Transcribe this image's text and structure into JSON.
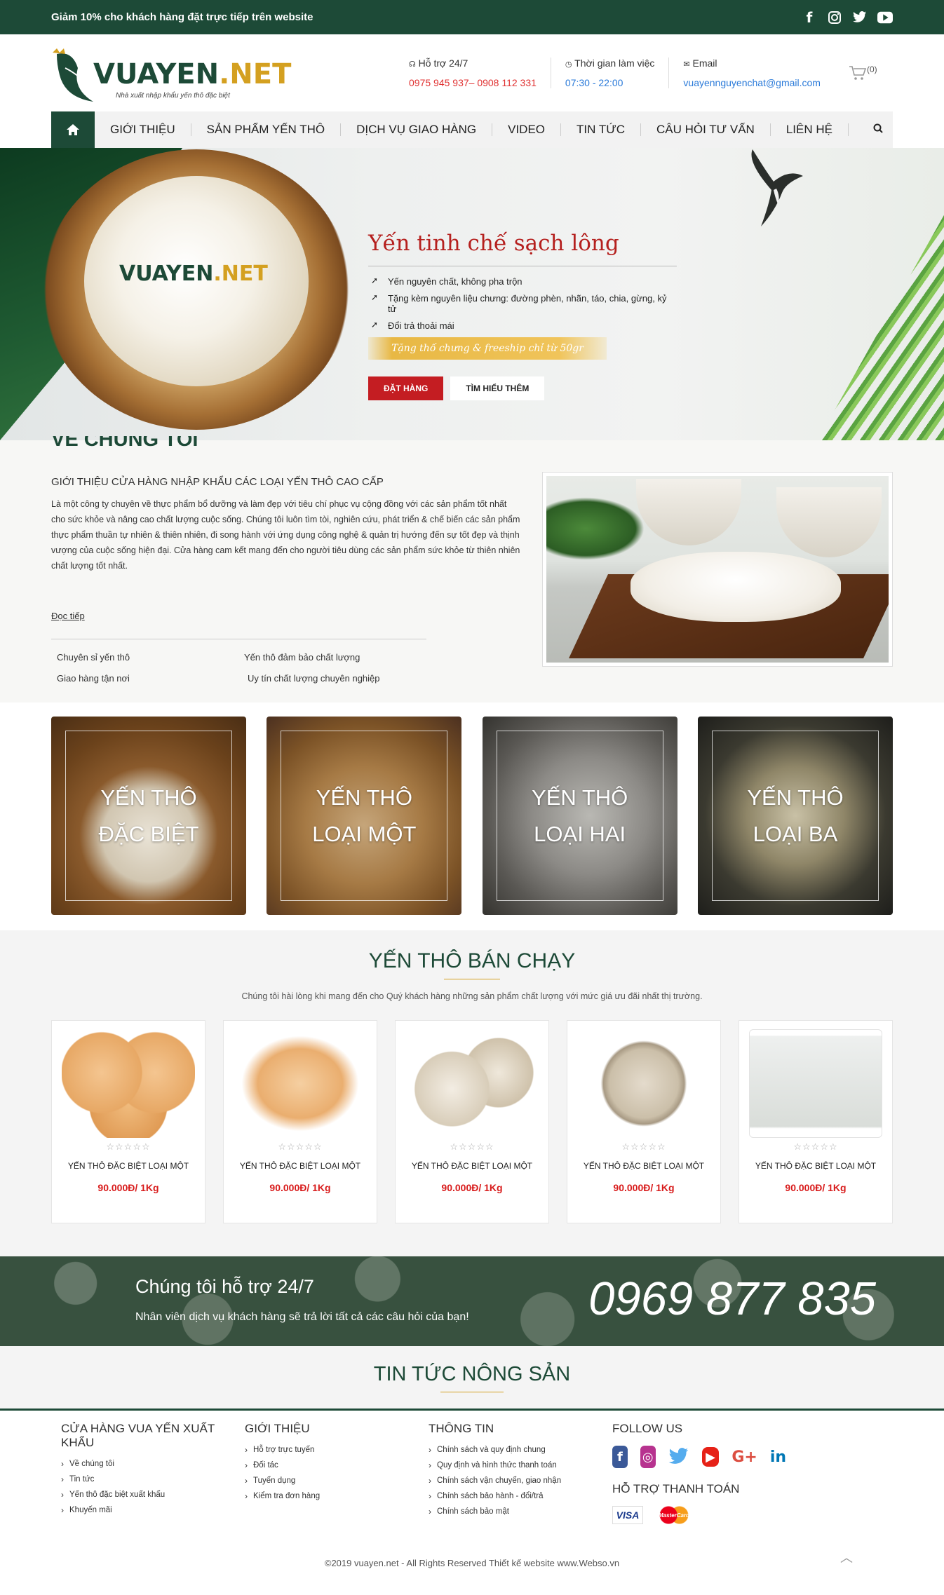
{
  "topbar": {
    "promo": "Giảm 10% cho khách hàng đặt trực tiếp trên website"
  },
  "social_top": {
    "facebook": "f",
    "instagram": "◘",
    "twitter": "🐦",
    "youtube": "▶"
  },
  "logo": {
    "brand": "VUAYEN",
    "tld": ".NET",
    "tagline": "Nhà xuất nhập khẩu yến thô đặc biệt"
  },
  "contacts": [
    {
      "icon": "headset-icon",
      "label": "Hỗ trợ 24/7",
      "value": "0975 945 937– 0908 112 331"
    },
    {
      "icon": "clock-icon",
      "label": "Thời gian làm việc",
      "value": "07:30 - 22:00"
    },
    {
      "icon": "mail-icon",
      "label": "Email",
      "value": "vuayennguyenchat@gmail.com"
    }
  ],
  "cart": {
    "count": "(0)"
  },
  "nav": {
    "items": [
      "GIỚI THIỆU",
      "SẢN PHẨM YẾN THÔ",
      "DỊCH VỤ GIAO HÀNG",
      "VIDEO",
      "TIN TỨC",
      "CÂU HỎI TƯ VẤN",
      "LIÊN HỆ"
    ]
  },
  "hero": {
    "logo_brand": "VUAYEN",
    "logo_tld": ".NET",
    "title": "Yến tinh chế sạch lông",
    "bullets": [
      "Yến nguyên chất, không pha trộn",
      "Tặng kèm nguyên liệu chưng: đường phèn, nhãn, táo, chia, gừng, kỷ tử",
      "Đổi trả thoải mái"
    ],
    "ribbon": "Tặng thố chưng & freeship chỉ từ 50gr",
    "btn_order": "ĐẶT HÀNG",
    "btn_more": "TÌM HIỂU THÊM"
  },
  "about": {
    "title": "VỀ CHÚNG TÔI",
    "subtitle": "GIỚI THIỆU CỬA HÀNG NHẬP KHẨU CÁC LOẠI YẾN THÔ CAO CẤP",
    "body": "Là một công ty chuyên về thực phẩm bổ dưỡng và làm đẹp với tiêu chí phục vụ cộng đồng với các sản phẩm tốt nhất cho sức khỏe và nâng cao chất lượng cuộc sống. Chúng tôi luôn tìm tòi, nghiên cứu, phát triển & chế biến các sản phẩm thực phẩm thuần tự nhiên & thiên nhiên, đi song hành với ứng dụng công nghệ & quản trị hướng đến sự tốt đẹp và thịnh vượng của cuộc sống hiện đại. Cửa hàng cam kết mang đến cho người tiêu dùng các sản phẩm sức khỏe từ thiên nhiên chất lượng tốt nhất.",
    "more": "Đọc tiếp",
    "features": [
      "Chuyên sỉ yến thô",
      "Yến thô đảm bảo chất lượng",
      "Giao hàng tận nơi",
      "Uy tín chất lượng chuyên nghiệp"
    ]
  },
  "categories": [
    {
      "line1": "YẾN THÔ",
      "line2": "ĐẶC BIỆT"
    },
    {
      "line1": "YẾN THÔ",
      "line2": "LOẠI MỘT"
    },
    {
      "line1": "YẾN THÔ",
      "line2": "LOẠI HAI"
    },
    {
      "line1": "YẾN THÔ",
      "line2": "LOẠI BA"
    }
  ],
  "best": {
    "title": "YẾN THÔ BÁN CHẠY",
    "desc": "Chúng tôi hài lòng khi mang đến cho Quý khách hàng những sản phẩm chất lượng với mức giá ưu đãi nhất thị trường.",
    "products": [
      {
        "name": "YẾN THÔ ĐẶC BIỆT LOẠI MỘT",
        "price": "90.000Đ/ 1Kg",
        "stars": "☆☆☆☆☆"
      },
      {
        "name": "YẾN THÔ ĐẶC BIỆT LOẠI MỘT",
        "price": "90.000Đ/ 1Kg",
        "stars": "☆☆☆☆☆"
      },
      {
        "name": "YẾN THÔ ĐẶC BIỆT LOẠI MỘT",
        "price": "90.000Đ/ 1Kg",
        "stars": "☆☆☆☆☆"
      },
      {
        "name": "YẾN THÔ ĐẶC BIỆT LOẠI MỘT",
        "price": "90.000Đ/ 1Kg",
        "stars": "☆☆☆☆☆"
      },
      {
        "name": "YẾN THÔ ĐẶC BIỆT LOẠI MỘT",
        "price": "90.000Đ/ 1Kg",
        "stars": "☆☆☆☆☆"
      }
    ]
  },
  "support": {
    "title": "Chúng tôi hỗ trợ 24/7",
    "subtitle": "Nhân viên dịch vụ khách hàng sẽ trả lời tất cả các câu hỏi của bạn!",
    "phone": "0969 877 835"
  },
  "news": {
    "title": "TIN TỨC NÔNG SẢN"
  },
  "footer": {
    "col1": {
      "title": "CỬA HÀNG VUA YẾN XUẤT KHẨU",
      "items": [
        "Về chúng tôi",
        "Tin tức",
        "Yến thô đặc biệt xuất khẩu",
        "Khuyến mãi"
      ]
    },
    "col2": {
      "title": "GIỚI THIỆU",
      "items": [
        "Hỗ trợ trực tuyến",
        "Đối tác",
        "Tuyển dụng",
        "Kiểm tra đơn hàng"
      ]
    },
    "col3": {
      "title": "THÔNG TIN",
      "items": [
        "Chính sách và quy định chung",
        "Quy định và hình thức thanh toán",
        "Chính sách vận chuyển, giao nhận",
        "Chính sách bảo hành - đổi/trả",
        "Chính sách bảo mật"
      ]
    },
    "col4": {
      "title": "FOLLOW US",
      "payment_title": "HỖ TRỢ THANH TOÁN",
      "visa": "VISA",
      "mastercard": "MasterCard"
    },
    "social": {
      "facebook": "f",
      "instagram": "◎",
      "twitter": "🐦",
      "youtube": "▶",
      "google": "G+",
      "linkedin": "in"
    },
    "copyright": "©2019 vuayen.net - All Rights Reserved Thiết kế website www.Webso.vn"
  },
  "colors": {
    "primary_green": "#1d4a37",
    "accent_red": "#c41d22",
    "accent_gold": "#d4a020",
    "link_blue": "#2a7ad9"
  }
}
